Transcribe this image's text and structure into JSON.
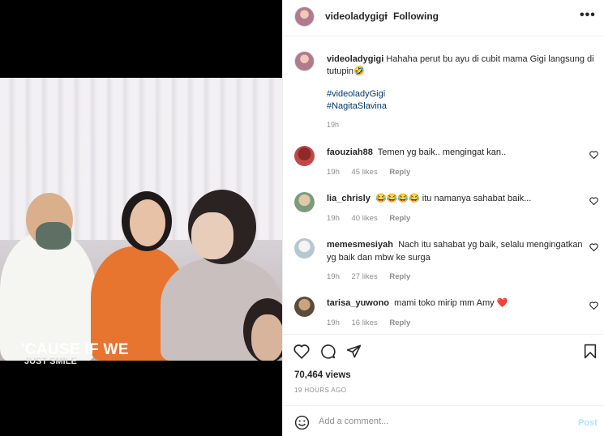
{
  "video": {
    "caption_line1": "'CAUSE IF WE",
    "caption_line2": "JUST SMILE"
  },
  "header": {
    "username": "videoladygigi",
    "separator": "•",
    "follow_status": "Following",
    "more_label": "•••"
  },
  "post_caption": {
    "username": "videoladygigi",
    "text": "Hahaha perut bu ayu di cubit mama Gigi langsung di tutupin🤣",
    "hashtags": [
      "#videoladyGigi",
      "#NagitaSlavina"
    ],
    "time": "19h"
  },
  "comments": [
    {
      "username": "faouziah88",
      "text": "Temen yg baik.. mengingat kan..",
      "time": "19h",
      "likes": "45 likes",
      "reply": "Reply"
    },
    {
      "username": "lia_chrisly",
      "text": "😂😂😂😂 itu namanya sahabat baik...",
      "time": "19h",
      "likes": "40 likes",
      "reply": "Reply"
    },
    {
      "username": "memesmesiyah",
      "text": "Nach itu sahabat yg baik, selalu mengingatkan yg baik dan mbw ke surga",
      "time": "19h",
      "likes": "27 likes",
      "reply": "Reply"
    },
    {
      "username": "tarisa_yuwono",
      "text": "mami toko mirip mm Amy ❤️",
      "time": "19h",
      "likes": "16 likes",
      "reply": "Reply"
    }
  ],
  "stats": {
    "views": "70,464 views",
    "time_ago": "19 HOURS AGO"
  },
  "add_comment": {
    "placeholder": "Add a comment...",
    "post_label": "Post"
  },
  "colors": {
    "link": "#00376b",
    "muted": "#8e8e8e",
    "post_disabled": "#b2dffc",
    "heart_red": "#ed4956"
  },
  "icons": [
    "more-icon",
    "heart-icon",
    "comment-icon",
    "share-icon",
    "bookmark-icon",
    "emoji-icon",
    "comment-heart-icon"
  ]
}
